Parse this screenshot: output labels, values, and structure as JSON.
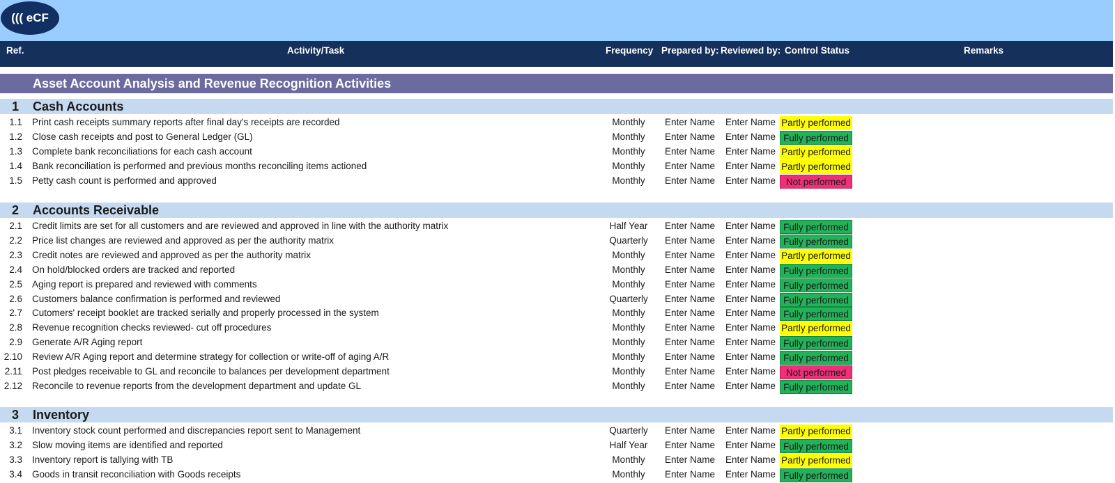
{
  "logo": {
    "text": "((( eCF"
  },
  "header": {
    "ref": "Ref.",
    "activity": "Activity/Task",
    "frequency": "Frequency",
    "prepared": "Prepared by:",
    "reviewed": "Reviewed by:",
    "status": "Control Status",
    "remarks": "Remarks"
  },
  "band_title": "Asset Account Analysis and Revenue Recognition Activities",
  "status_colors": {
    "Partly performed": "#ffff00",
    "Fully performed": "#22b25a",
    "Not performed": "#ef2f78"
  },
  "sections": [
    {
      "num": "1",
      "title": "Cash Accounts",
      "rows": [
        {
          "ref": "1.1",
          "activity": "Print cash receipts summary reports after final day's receipts are recorded",
          "frequency": "Monthly",
          "prepared": "Enter Name",
          "reviewed": "Enter Name",
          "status": "Partly performed"
        },
        {
          "ref": "1.2",
          "activity": "Close cash receipts and post to General Ledger (GL)",
          "frequency": "Monthly",
          "prepared": "Enter Name",
          "reviewed": "Enter Name",
          "status": "Fully performed"
        },
        {
          "ref": "1.3",
          "activity": "Complete bank reconciliations for each cash account",
          "frequency": "Monthly",
          "prepared": "Enter Name",
          "reviewed": "Enter Name",
          "status": "Partly performed"
        },
        {
          "ref": "1.4",
          "activity": "Bank reconciliation is performed and previous months reconciling items actioned",
          "frequency": "Monthly",
          "prepared": "Enter Name",
          "reviewed": "Enter Name",
          "status": "Partly performed"
        },
        {
          "ref": "1.5",
          "activity": "Petty cash count is performed and approved",
          "frequency": "Monthly",
          "prepared": "Enter Name",
          "reviewed": "Enter Name",
          "status": "Not performed"
        }
      ]
    },
    {
      "num": "2",
      "title": "Accounts Receivable",
      "rows": [
        {
          "ref": "2.1",
          "activity": "Credit limits are set for all customers and are reviewed and approved in line with the authority matrix",
          "frequency": "Half Year",
          "prepared": "Enter Name",
          "reviewed": "Enter Name",
          "status": "Fully performed"
        },
        {
          "ref": "2.2",
          "activity": "Price list changes are reviewed and approved as per the authority matrix",
          "frequency": "Quarterly",
          "prepared": "Enter Name",
          "reviewed": "Enter Name",
          "status": "Fully performed"
        },
        {
          "ref": "2.3",
          "activity": "Credit notes are reviewed and approved as per the authority matrix",
          "frequency": "Monthly",
          "prepared": "Enter Name",
          "reviewed": "Enter Name",
          "status": "Partly performed"
        },
        {
          "ref": "2.4",
          "activity": "On hold/blocked orders are tracked and reported",
          "frequency": "Monthly",
          "prepared": "Enter Name",
          "reviewed": "Enter Name",
          "status": "Fully performed"
        },
        {
          "ref": "2.5",
          "activity": "Aging report is prepared and reviewed with comments",
          "frequency": "Monthly",
          "prepared": "Enter Name",
          "reviewed": "Enter Name",
          "status": "Fully performed"
        },
        {
          "ref": "2.6",
          "activity": "Customers balance confirmation is performed and reviewed",
          "frequency": "Quarterly",
          "prepared": "Enter Name",
          "reviewed": "Enter Name",
          "status": "Fully performed"
        },
        {
          "ref": "2.7",
          "activity": "Cutomers' receipt booklet are tracked serially and properly processed in the system",
          "frequency": "Monthly",
          "prepared": "Enter Name",
          "reviewed": "Enter Name",
          "status": "Fully performed"
        },
        {
          "ref": "2.8",
          "activity": "Revenue recognition checks reviewed- cut off procedures",
          "frequency": "Monthly",
          "prepared": "Enter Name",
          "reviewed": "Enter Name",
          "status": "Partly performed"
        },
        {
          "ref": "2.9",
          "activity": "Generate A/R Aging report",
          "frequency": "Monthly",
          "prepared": "Enter Name",
          "reviewed": "Enter Name",
          "status": "Fully performed"
        },
        {
          "ref": "2.10",
          "activity": "Review A/R Aging report and determine strategy for collection or write-off of aging A/R",
          "frequency": "Monthly",
          "prepared": "Enter Name",
          "reviewed": "Enter Name",
          "status": "Fully performed"
        },
        {
          "ref": "2.11",
          "activity": "Post pledges receivable to GL and reconcile to balances per development department",
          "frequency": "Monthly",
          "prepared": "Enter Name",
          "reviewed": "Enter Name",
          "status": "Not performed"
        },
        {
          "ref": "2.12",
          "activity": "Reconcile to revenue reports from the development department and update GL",
          "frequency": "Monthly",
          "prepared": "Enter Name",
          "reviewed": "Enter Name",
          "status": "Fully performed"
        }
      ]
    },
    {
      "num": "3",
      "title": "Inventory",
      "rows": [
        {
          "ref": "3.1",
          "activity": "Inventory stock count performed and discrepancies report sent to Management",
          "frequency": "Quarterly",
          "prepared": "Enter Name",
          "reviewed": "Enter Name",
          "status": "Partly performed"
        },
        {
          "ref": "3.2",
          "activity": "Slow moving items are identified and reported",
          "frequency": "Half Year",
          "prepared": "Enter Name",
          "reviewed": "Enter Name",
          "status": "Fully performed"
        },
        {
          "ref": "3.3",
          "activity": "Inventory report is tallying with TB",
          "frequency": "Monthly",
          "prepared": "Enter Name",
          "reviewed": "Enter Name",
          "status": "Partly performed"
        },
        {
          "ref": "3.4",
          "activity": "Goods in transit reconciliation with Goods receipts",
          "frequency": "Monthly",
          "prepared": "Enter Name",
          "reviewed": "Enter Name",
          "status": "Fully performed"
        }
      ]
    }
  ]
}
